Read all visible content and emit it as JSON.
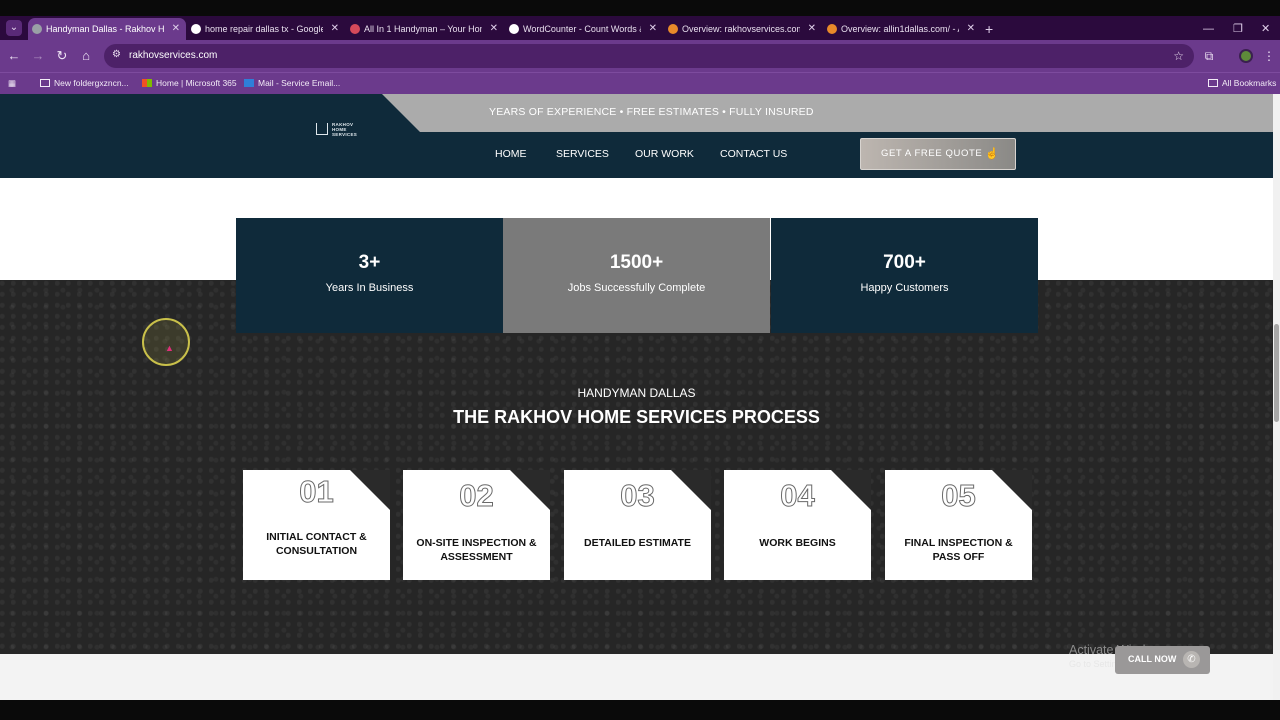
{
  "browser": {
    "tabs": [
      {
        "title": "Handyman Dallas - Rakhov Ho",
        "fav_color": "#9aa0a6",
        "active": true
      },
      {
        "title": "home repair dallas tx - Google",
        "fav_color": "#ffffff",
        "active": false
      },
      {
        "title": "All In 1 Handyman – Your Hom",
        "fav_color": "#d64a5a",
        "active": false
      },
      {
        "title": "WordCounter - Count Words &",
        "fav_color": "#ffffff",
        "active": false
      },
      {
        "title": "Overview: rakhovservices.com/",
        "fav_color": "#e88a2a",
        "active": false
      },
      {
        "title": "Overview: allin1dallas.com/ - Al",
        "fav_color": "#e88a2a",
        "active": false
      }
    ],
    "url": "rakhovservices.com",
    "bookmarks": [
      {
        "label": "New foldergxzncn...",
        "icon": "folder-icon"
      },
      {
        "label": "Home | Microsoft 365",
        "icon": "microsoft-icon"
      },
      {
        "label": "Mail - Service Email...",
        "icon": "outlook-icon"
      }
    ],
    "all_bookmarks": "All Bookmarks"
  },
  "site": {
    "topstrip": "YEARS OF EXPERIENCE • FREE ESTIMATES • FULLY INSURED",
    "logo_lines": [
      "RAKHOV",
      "HOME",
      "SERVICES"
    ],
    "nav": [
      "HOME",
      "SERVICES",
      "OUR WORK",
      "CONTACT US"
    ],
    "quote_button": "GET A FREE QUOTE",
    "stats": [
      {
        "num": "3+",
        "label": "Years In Business",
        "bg": "#0f2a3a"
      },
      {
        "num": "1500+",
        "label": "Jobs Successfully Complete",
        "bg": "#7a7a7a"
      },
      {
        "num": "700+",
        "label": "Happy Customers",
        "bg": "#0f2a3a"
      }
    ],
    "process_eyebrow": "HANDYMAN DALLAS",
    "process_title": "THE RAKHOV HOME SERVICES PROCESS",
    "steps": [
      {
        "num": "01",
        "title": "INITIAL CONTACT & CONSULTATION"
      },
      {
        "num": "02",
        "title": "ON-SITE INSPECTION & ASSESSMENT"
      },
      {
        "num": "03",
        "title": "DETAILED ESTIMATE"
      },
      {
        "num": "04",
        "title": "WORK BEGINS"
      },
      {
        "num": "05",
        "title": "FINAL INSPECTION & PASS OFF"
      }
    ],
    "call_now": "CALL NOW"
  },
  "overlay": {
    "activate_title": "Activate Windo",
    "activate_sub": "Go to Settin        ows."
  }
}
